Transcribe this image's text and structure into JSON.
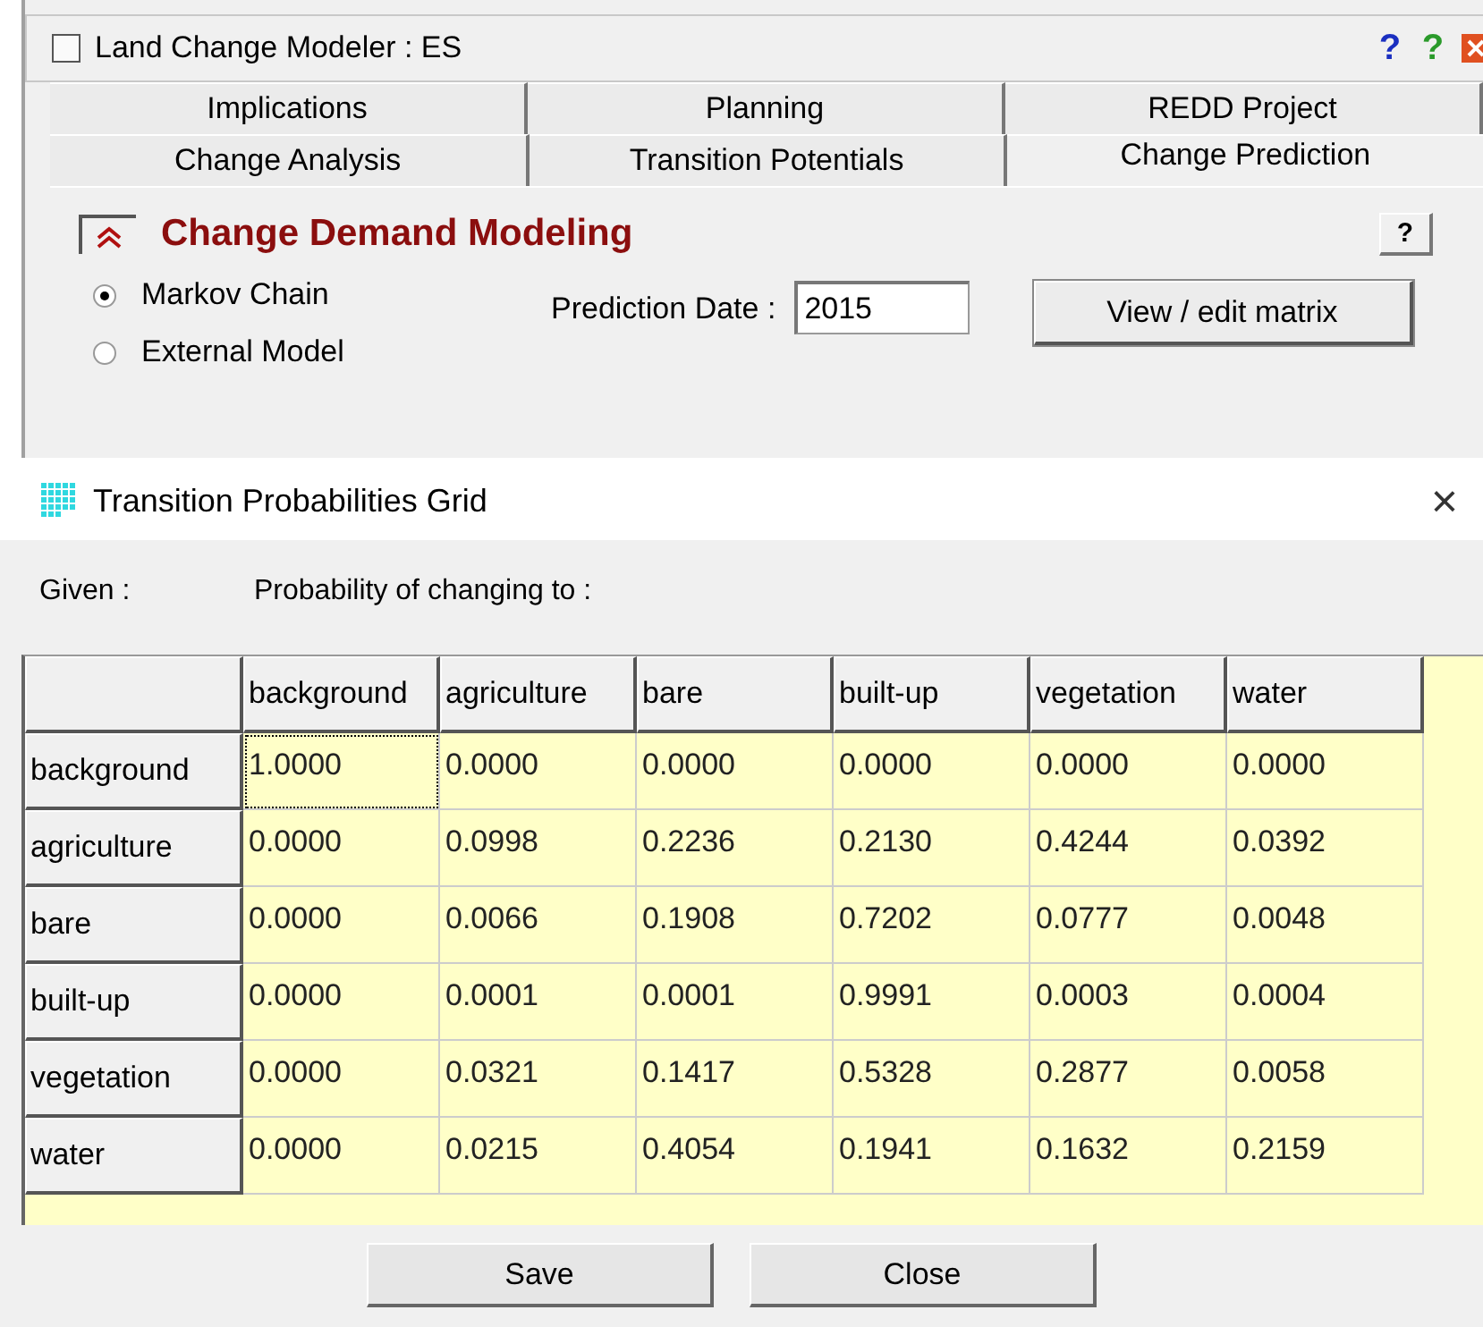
{
  "modeler": {
    "title": "Land Change Modeler : ES",
    "help_marks": [
      "?",
      "?"
    ],
    "tabs": [
      [
        {
          "label": "Implications",
          "selected": false
        },
        {
          "label": "Planning",
          "selected": false
        },
        {
          "label": "REDD Project",
          "selected": false
        }
      ],
      [
        {
          "label": "Change Analysis",
          "selected": false
        },
        {
          "label": "Transition Potentials",
          "selected": false
        },
        {
          "label": "Change Prediction",
          "selected": true
        }
      ]
    ],
    "section": {
      "title": "Change Demand Modeling",
      "help": "?"
    },
    "options": [
      {
        "label": "Markov Chain",
        "selected": true
      },
      {
        "label": "External Model",
        "selected": false
      }
    ],
    "prediction_date": {
      "label": "Prediction Date :",
      "value": "2015"
    },
    "matrix_button": "View / edit matrix"
  },
  "dialog": {
    "title": "Transition Probabilities Grid",
    "close": "×",
    "given_label": "Given :",
    "to_label": "Probability of changing to :",
    "columns": [
      "background",
      "agriculture",
      "bare",
      "built-up",
      "vegetation",
      "water"
    ],
    "rows": [
      {
        "name": "background",
        "cells": [
          {
            "value": "1.0000",
            "focused": true
          },
          {
            "value": "0.0000",
            "focused": false
          },
          {
            "value": "0.0000",
            "focused": false
          },
          {
            "value": "0.0000",
            "focused": false
          },
          {
            "value": "0.0000",
            "focused": false
          },
          {
            "value": "0.0000",
            "focused": false
          }
        ]
      },
      {
        "name": "agriculture",
        "cells": [
          {
            "value": "0.0000",
            "focused": false
          },
          {
            "value": "0.0998",
            "focused": false
          },
          {
            "value": "0.2236",
            "focused": false
          },
          {
            "value": "0.2130",
            "focused": false
          },
          {
            "value": "0.4244",
            "focused": false
          },
          {
            "value": "0.0392",
            "focused": false
          }
        ]
      },
      {
        "name": "bare",
        "cells": [
          {
            "value": "0.0000",
            "focused": false
          },
          {
            "value": "0.0066",
            "focused": false
          },
          {
            "value": "0.1908",
            "focused": false
          },
          {
            "value": "0.7202",
            "focused": false
          },
          {
            "value": "0.0777",
            "focused": false
          },
          {
            "value": "0.0048",
            "focused": false
          }
        ]
      },
      {
        "name": "built-up",
        "cells": [
          {
            "value": "0.0000",
            "focused": false
          },
          {
            "value": "0.0001",
            "focused": false
          },
          {
            "value": "0.0001",
            "focused": false
          },
          {
            "value": "0.9991",
            "focused": false
          },
          {
            "value": "0.0003",
            "focused": false
          },
          {
            "value": "0.0004",
            "focused": false
          }
        ]
      },
      {
        "name": "vegetation",
        "cells": [
          {
            "value": "0.0000",
            "focused": false
          },
          {
            "value": "0.0321",
            "focused": false
          },
          {
            "value": "0.1417",
            "focused": false
          },
          {
            "value": "0.5328",
            "focused": false
          },
          {
            "value": "0.2877",
            "focused": false
          },
          {
            "value": "0.0058",
            "focused": false
          }
        ]
      },
      {
        "name": "water",
        "cells": [
          {
            "value": "0.0000",
            "focused": false
          },
          {
            "value": "0.0215",
            "focused": false
          },
          {
            "value": "0.4054",
            "focused": false
          },
          {
            "value": "0.1941",
            "focused": false
          },
          {
            "value": "0.1632",
            "focused": false
          },
          {
            "value": "0.2159",
            "focused": false
          }
        ]
      }
    ],
    "buttons": [
      "Save",
      "Close"
    ]
  }
}
